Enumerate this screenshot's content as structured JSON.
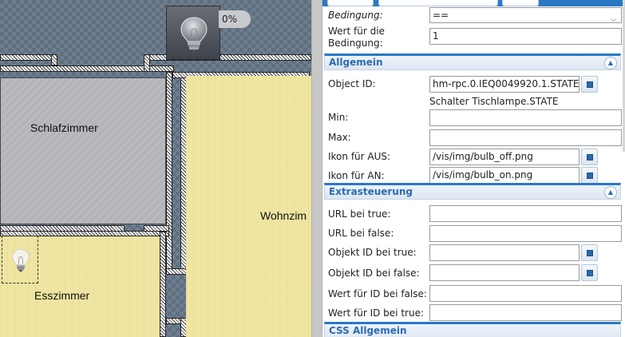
{
  "canvas": {
    "rooms": {
      "schlafzimmer": "Schlafzimmer",
      "wohnzimmer": "Wohnzim",
      "esszimmer": "Esszimmer"
    },
    "bulb_widget": {
      "percent": "0%",
      "icon": "bulb-off-icon"
    },
    "bulb_small": {
      "icon": "bulb-off-icon"
    }
  },
  "panel": {
    "tabs": [
      "",
      "",
      ""
    ],
    "accent_color": "#2a78c5",
    "fields_top": [
      {
        "label": "Bedingung:",
        "value": "=="
      },
      {
        "label_1": "Wert für die",
        "label_2": "Bedingung:",
        "value": "1"
      }
    ],
    "sections": {
      "allgemein": "Allgemein",
      "extrasteuerung": "Extrasteuerung",
      "css_allgemein": "CSS Allgemein"
    },
    "allgemein": {
      "object_id": {
        "label": "Object ID:",
        "value": "hm-rpc.0.IEQ0049920.1.STATE",
        "hint": "Schalter Tischlampe.STATE"
      },
      "min": {
        "label": "Min:",
        "value": ""
      },
      "max": {
        "label": "Max:",
        "value": ""
      },
      "icon_off": {
        "label": "Ikon für AUS:",
        "value": "/vis/img/bulb_off.png"
      },
      "icon_on": {
        "label": "Ikon für AN:",
        "value": "/vis/img/bulb_on.png"
      }
    },
    "extrasteuerung": {
      "url_true": {
        "label": "URL bei true:",
        "value": ""
      },
      "url_false": {
        "label": "URL bei false:",
        "value": ""
      },
      "oid_true": {
        "label": "Objekt ID bei true:",
        "value": ""
      },
      "oid_false": {
        "label": "Objekt ID bei false:",
        "value": ""
      },
      "val_false": {
        "label": "Wert für ID bei false:",
        "value": ""
      },
      "val_true": {
        "label": "Wert für ID bei true:",
        "value": ""
      }
    }
  }
}
